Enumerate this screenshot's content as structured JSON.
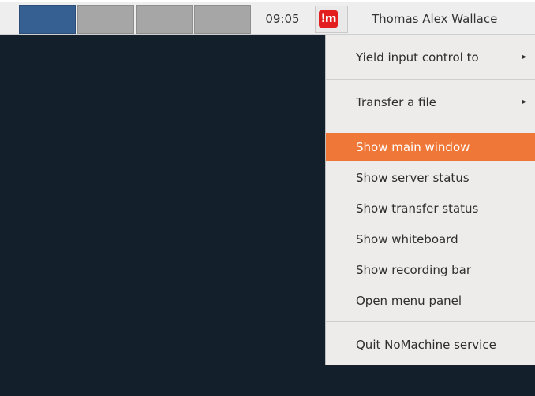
{
  "panel": {
    "clock": "09:05",
    "user_name": "Thomas Alex Wallace",
    "tray_icon": "nomachine-tray-icon",
    "workspaces": [
      {
        "active": true
      },
      {
        "active": false
      },
      {
        "active": false
      },
      {
        "active": false
      }
    ]
  },
  "menu": {
    "yield_input": "Yield input control to",
    "transfer_file": "Transfer a file",
    "show_main_window": "Show main window",
    "show_server_status": "Show server status",
    "show_transfer_status": "Show transfer status",
    "show_whiteboard": "Show whiteboard",
    "show_recording_bar": "Show recording bar",
    "open_menu_panel": "Open menu panel",
    "quit_service": "Quit NoMachine service",
    "submenu_arrow": "▸"
  },
  "colors": {
    "desktop": "#141f2c",
    "highlight": "#ef7737",
    "menu_bg": "#edeceb",
    "workspace_active": "#365f92"
  }
}
